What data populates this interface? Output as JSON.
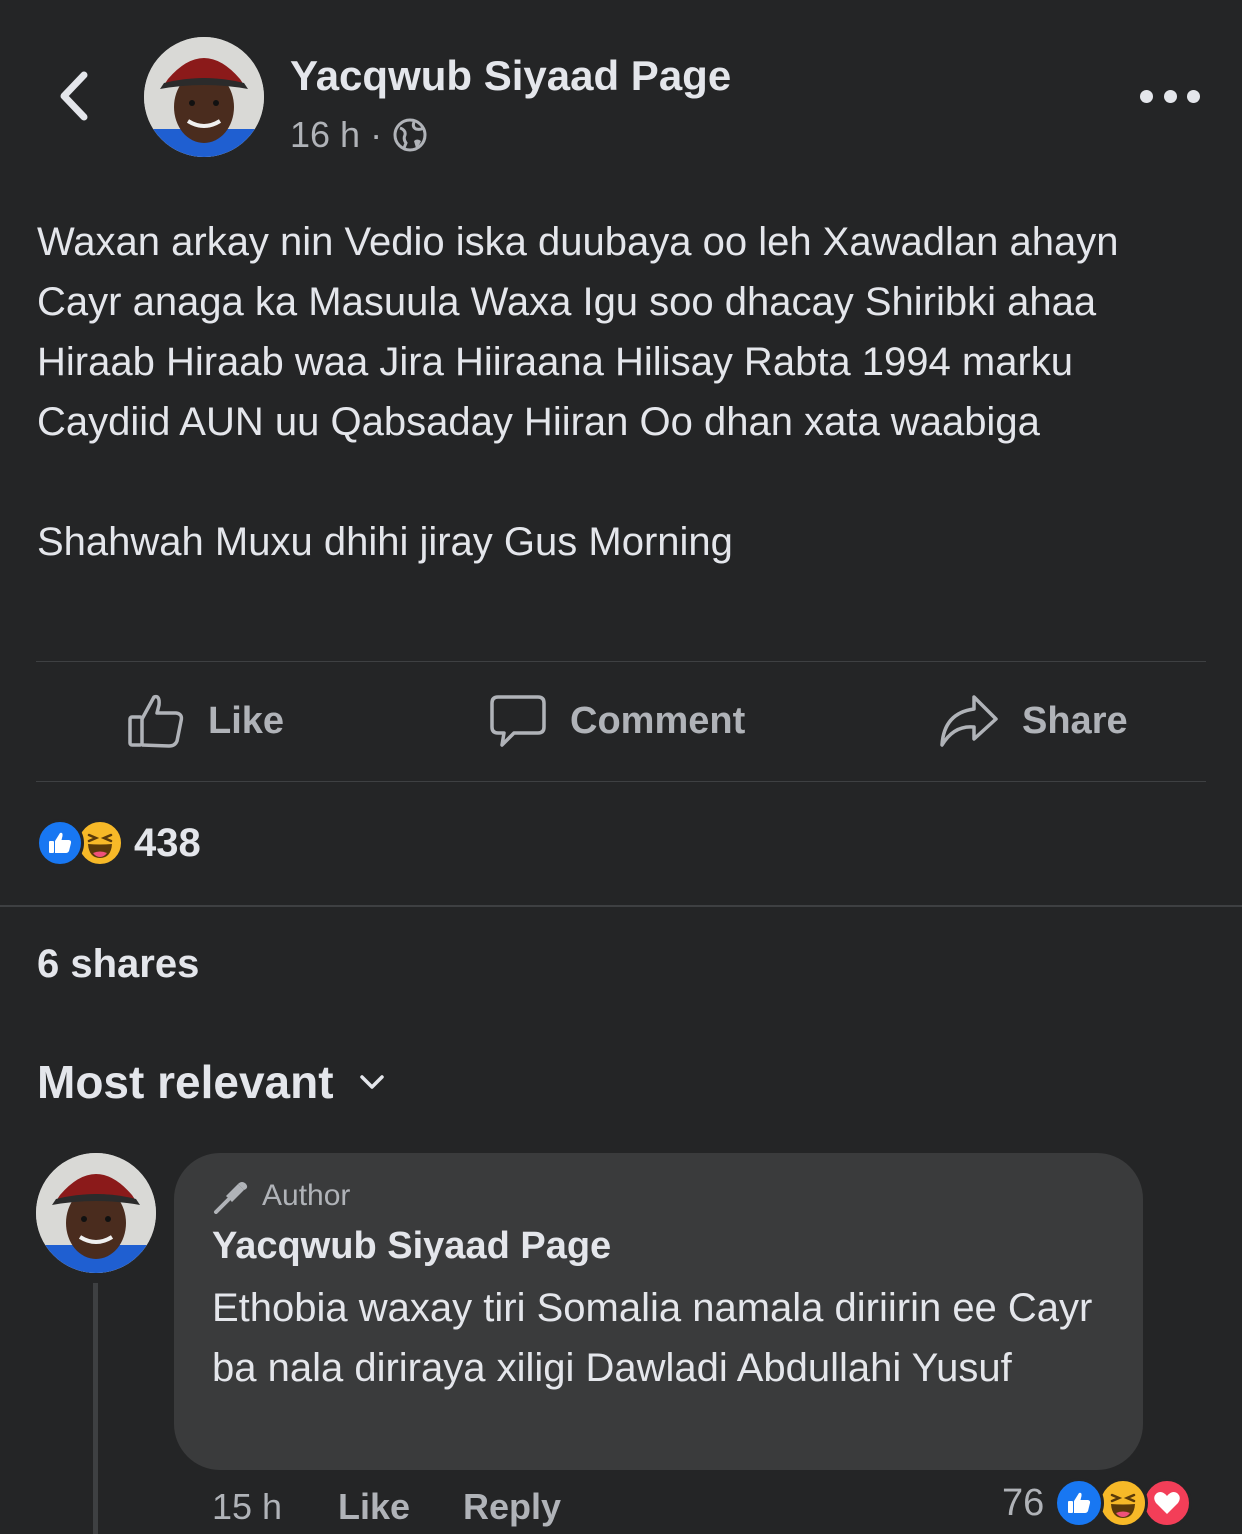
{
  "post": {
    "page_name": "Yacqwub Siyaad Page",
    "time": "16 h",
    "separator": "·",
    "privacy_icon": "globe-icon",
    "text_paragraphs": [
      "Waxan arkay nin Vedio iska duubaya oo leh Xawadlan ahayn Cayr anaga ka Masuula Waxa Igu soo dhacay Shiribki ahaa Hiraab Hiraab waa Jira Hiiraana Hilisay Rabta 1994 marku Caydiid AUN uu Qabsaday Hiiran Oo dhan xata waabiga",
      "Shahwah Muxu dhihi jiray Gus Morning"
    ]
  },
  "actions": {
    "like": "Like",
    "comment": "Comment",
    "share": "Share"
  },
  "reactions": {
    "count": "438",
    "types": [
      "like",
      "haha"
    ]
  },
  "shares_text": "6 shares",
  "sort_label": "Most relevant",
  "comment": {
    "badge": "Author",
    "author": "Yacqwub Siyaad Page",
    "text": "Ethobia waxay tiri Somalia namala diriirin ee Cayr ba nala diriraya xiligi Dawladi Abdullahi Yusuf",
    "time": "15 h",
    "like": "Like",
    "reply": "Reply",
    "reaction_count": "76",
    "reaction_types": [
      "like",
      "haha",
      "love"
    ]
  },
  "colors": {
    "background": "#242526",
    "text_primary": "#e4e6eb",
    "text_secondary": "#b0b3b8",
    "bubble": "#3a3b3c",
    "divider": "#3e4042",
    "like_blue": "#1877f2",
    "love_red": "#f33e58",
    "haha_yellow": "#f7b928"
  }
}
